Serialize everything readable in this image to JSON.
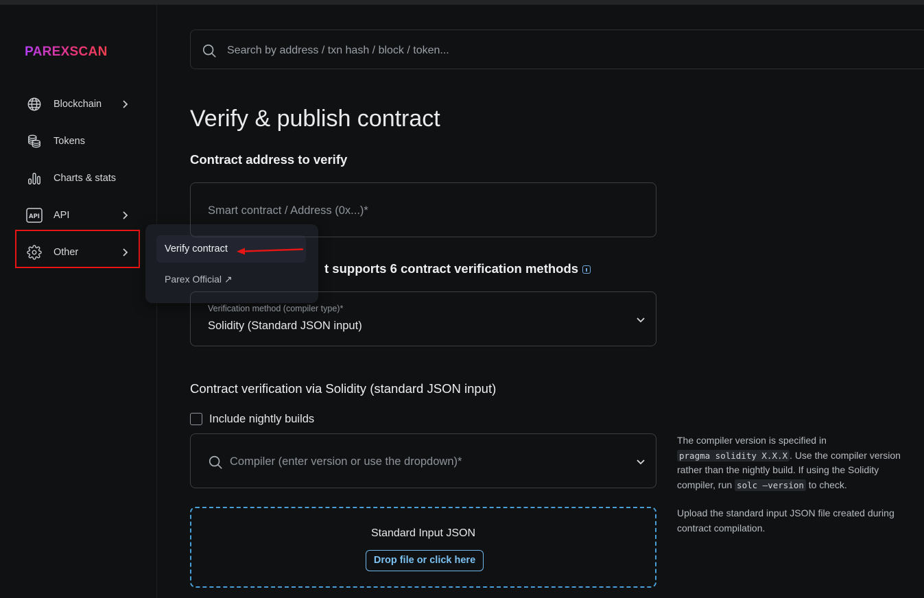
{
  "app": {
    "logo_text": "PAREXSCAN"
  },
  "search": {
    "placeholder": "Search by address / txn hash / block / token..."
  },
  "sidebar": {
    "items": [
      {
        "label": "Blockchain",
        "icon": "globe-icon",
        "has_chevron": true
      },
      {
        "label": "Tokens",
        "icon": "coins-icon",
        "has_chevron": false
      },
      {
        "label": "Charts & stats",
        "icon": "bar-chart-icon",
        "has_chevron": false
      },
      {
        "label": "API",
        "icon": "api-icon",
        "has_chevron": true
      },
      {
        "label": "Other",
        "icon": "gear-icon",
        "has_chevron": true
      }
    ]
  },
  "other_menu": {
    "items": [
      {
        "label": "Verify contract",
        "active": true
      },
      {
        "label": "Parex Official ↗",
        "external": true
      }
    ]
  },
  "page": {
    "title": "Verify & publish contract",
    "address_section_title": "Contract address to verify",
    "address_placeholder": "Smart contract / Address (0x...)*",
    "methods_text": "t supports 6 contract verification methods",
    "method_label": "Verification method (compiler type)*",
    "method_value": "Solidity (Standard JSON input)",
    "solidity_section_title": "Contract verification via Solidity (standard JSON input)",
    "nightly_label": "Include nightly builds",
    "compiler_placeholder": "Compiler (enter version or use the dropdown)*",
    "help_compiler": {
      "part1": "The compiler version is specified in",
      "code1": "pragma solidity X.X.X",
      "part2": ". Use the compiler version rather than the nightly build. If using the Solidity compiler, run",
      "code2": "solc —version",
      "part3": "to check."
    },
    "help_upload": "Upload the standard input JSON file created during contract compilation.",
    "dropzone_title": "Standard Input JSON",
    "dropzone_button": "Drop file or click here"
  },
  "colors": {
    "background": "#101112",
    "highlight_border": "#e81515",
    "accent_blue": "#4a9fd8",
    "logo_gradient_start": "#b23cf0",
    "logo_gradient_end": "#f2404f"
  }
}
